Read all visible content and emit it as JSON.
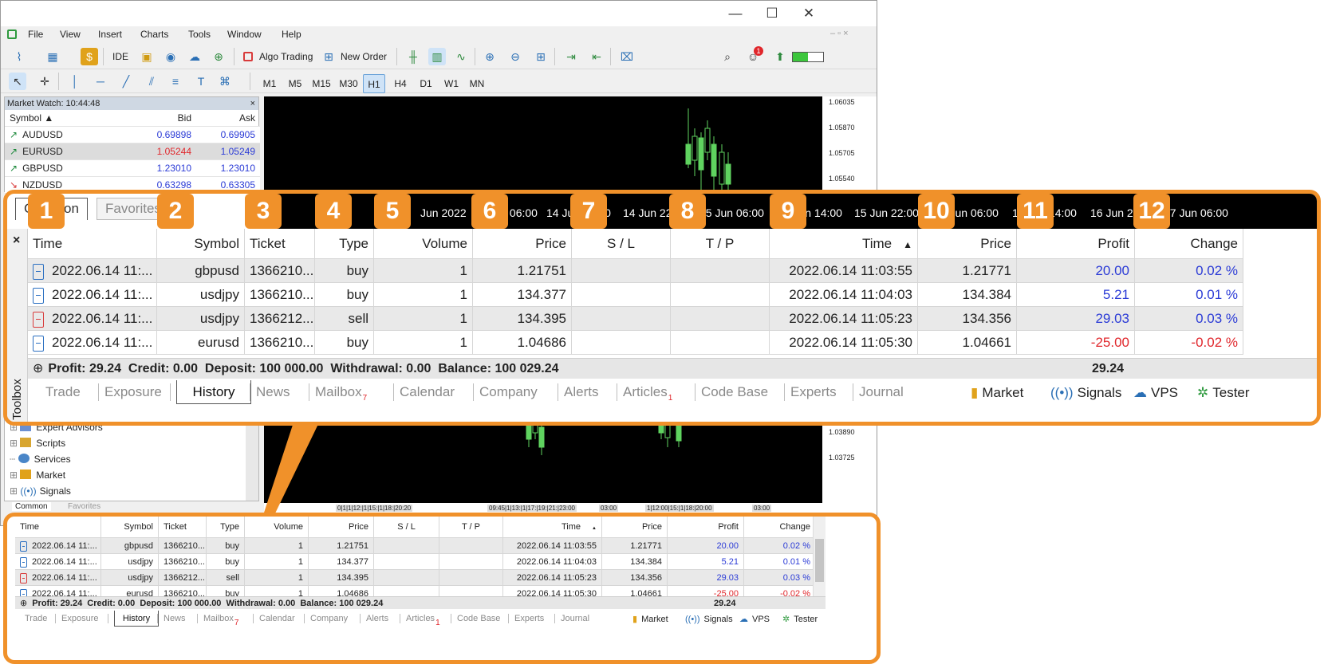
{
  "window": {
    "menu": [
      "File",
      "View",
      "Insert",
      "Charts",
      "Tools",
      "Window",
      "Help"
    ],
    "controls": {
      "minimize": "—",
      "maximize": "☐",
      "close": "✕"
    }
  },
  "toolbar": {
    "ide_label": "IDE",
    "algo_trading_label": "Algo Trading",
    "new_order_label": "New Order",
    "notifications_badge": "1"
  },
  "timeframes": [
    "M1",
    "M5",
    "M15",
    "M30",
    "H1",
    "H4",
    "D1",
    "W1",
    "MN"
  ],
  "active_timeframe": "H1",
  "market_watch": {
    "title": "Market Watch: 10:44:48",
    "headers": [
      "Symbol",
      "Bid",
      "Ask"
    ],
    "rows": [
      {
        "symbol": "AUDUSD",
        "bid": "0.69898",
        "ask": "0.69905",
        "dir": "up"
      },
      {
        "symbol": "EURUSD",
        "bid": "1.05244",
        "ask": "1.05249",
        "dir": "up"
      },
      {
        "symbol": "GBPUSD",
        "bid": "1.23010",
        "ask": "1.23010",
        "dir": "up"
      },
      {
        "symbol": "NZDUSD",
        "bid": "0.63298",
        "ask": "0.63305",
        "dir": "down"
      }
    ]
  },
  "chart_top_scale": [
    "1.06035",
    "1.05870",
    "1.05705",
    "1.05540"
  ],
  "chart_bottom_scale": [
    "1.03890",
    "1.03725"
  ],
  "chart_bottom_times": [
    "0|1|1|12:|1|15:|1|18:|20:20",
    "09:45|1|13:|1|17:|19:|21:|23:00",
    "03:00",
    "1|12:00|15:|1|18:|20:00",
    "03:00"
  ],
  "navigator": {
    "items": [
      "Expert Advisors",
      "Scripts",
      "Services",
      "Market",
      "Signals"
    ],
    "tabs": [
      "Common",
      "Favorites"
    ]
  },
  "zoom": {
    "top_tabs": [
      "Common",
      "Favorites"
    ],
    "time_strip": [
      "Jun 2022",
      "14 Jun 06:00",
      "14 Jun 14:00",
      "14 Jun 22:00",
      "15 Jun 06:00",
      "15 Jun 14:00",
      "15 Jun 22:00",
      "16 Jun 06:00",
      "16 Jun 14:00",
      "16 Jun 22:00",
      "17 Jun 06:00"
    ],
    "badges": [
      "1",
      "2",
      "3",
      "4",
      "5",
      "6",
      "7",
      "8",
      "9",
      "10",
      "11",
      "12"
    ]
  },
  "toolbox": {
    "label": "Toolbox",
    "close_symbol": "×",
    "sort_indicator": "▲",
    "headers": [
      "Time",
      "Symbol",
      "Ticket",
      "Type",
      "Volume",
      "Price",
      "S / L",
      "T / P",
      "Time",
      "Price",
      "Profit",
      "Change"
    ],
    "rows": [
      {
        "open_time": "2022.06.14 11:...",
        "symbol": "gbpusd",
        "ticket": "1366210...",
        "type": "buy",
        "volume": "1",
        "open_price": "1.21751",
        "sl": "",
        "tp": "",
        "close_time": "2022.06.14 11:03:55",
        "close_price": "1.21771",
        "profit": "20.00",
        "change": "0.02 %"
      },
      {
        "open_time": "2022.06.14 11:...",
        "symbol": "usdjpy",
        "ticket": "1366210...",
        "type": "buy",
        "volume": "1",
        "open_price": "134.377",
        "sl": "",
        "tp": "",
        "close_time": "2022.06.14 11:04:03",
        "close_price": "134.384",
        "profit": "5.21",
        "change": "0.01 %"
      },
      {
        "open_time": "2022.06.14 11:...",
        "symbol": "usdjpy",
        "ticket": "1366212...",
        "type": "sell",
        "volume": "1",
        "open_price": "134.395",
        "sl": "",
        "tp": "",
        "close_time": "2022.06.14 11:05:23",
        "close_price": "134.356",
        "profit": "29.03",
        "change": "0.03 %"
      },
      {
        "open_time": "2022.06.14 11:...",
        "symbol": "eurusd",
        "ticket": "1366210...",
        "type": "buy",
        "volume": "1",
        "open_price": "1.04686",
        "sl": "",
        "tp": "",
        "close_time": "2022.06.14 11:05:30",
        "close_price": "1.04661",
        "profit": "-25.00",
        "change": "-0.02 %"
      }
    ],
    "summary": "Profit: 29.24  Credit: 0.00  Deposit: 100 000.00  Withdrawal: 0.00  Balance: 100 029.24",
    "summary_total": "29.24",
    "tabs": [
      "Trade",
      "Exposure",
      "History",
      "News",
      "Mailbox",
      "Calendar",
      "Company",
      "Alerts",
      "Articles",
      "Code Base",
      "Experts",
      "Journal"
    ],
    "active_tab": "History",
    "mailbox_badge": "7",
    "articles_badge": "1",
    "right_tabs": [
      "Market",
      "Signals",
      "VPS",
      "Tester"
    ]
  },
  "colors": {
    "accent_orange": "#f0912a",
    "profit_blue": "#2b3bd6",
    "loss_red": "#e0262b",
    "candle_green": "#5fd35f"
  }
}
